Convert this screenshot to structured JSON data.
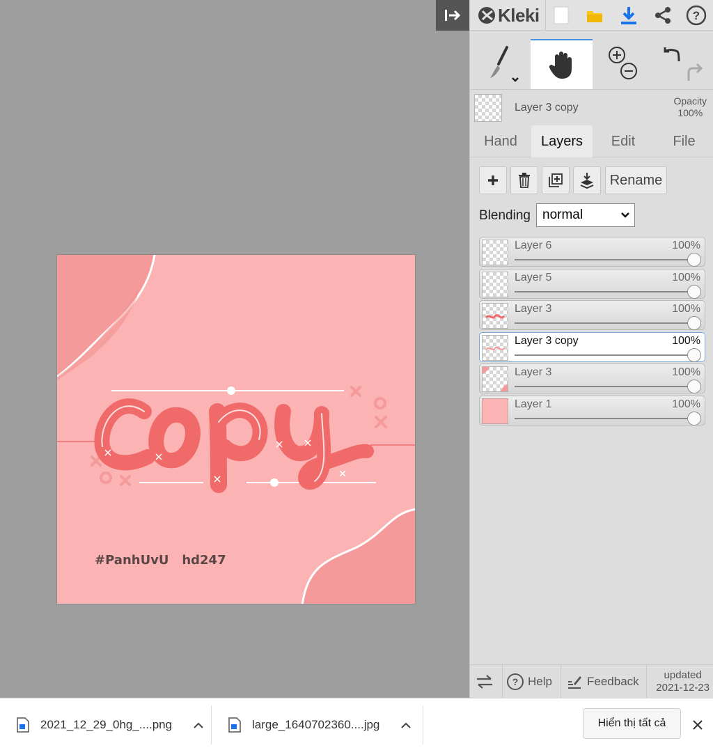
{
  "app": {
    "name": "Kleki",
    "colors": {
      "accent": "#1a73e8",
      "save_yellow": "#f5c518",
      "canvas_bg": "#fbb3b3",
      "panel_bg": "#dddddd"
    }
  },
  "toolbar": {
    "icons": [
      "new-image-icon",
      "open-folder-icon",
      "download-icon",
      "share-icon",
      "help-icon"
    ],
    "tools": [
      "brush-icon",
      "hand-icon",
      "zoom-in-icon",
      "zoom-out-icon",
      "undo-icon",
      "redo-icon"
    ],
    "active_tool": "hand"
  },
  "current_layer": {
    "name": "Layer 3 copy",
    "opacity_label": "Opacity",
    "opacity_value": "100%"
  },
  "tabs": [
    {
      "label": "Hand",
      "active": false
    },
    {
      "label": "Layers",
      "active": true
    },
    {
      "label": "Edit",
      "active": false
    },
    {
      "label": "File",
      "active": false
    }
  ],
  "layers_panel": {
    "rename_label": "Rename",
    "blending_label": "Blending",
    "blending_value": "normal",
    "layers": [
      {
        "name": "Layer 6",
        "opacity": "100%",
        "selected": false
      },
      {
        "name": "Layer 5",
        "opacity": "100%",
        "selected": false
      },
      {
        "name": "Layer 3",
        "opacity": "100%",
        "selected": false
      },
      {
        "name": "Layer 3 copy",
        "opacity": "100%",
        "selected": true
      },
      {
        "name": "Layer 3",
        "opacity": "100%",
        "selected": false
      },
      {
        "name": "Layer 1",
        "opacity": "100%",
        "selected": false
      }
    ]
  },
  "footer": {
    "help_label": "Help",
    "feedback_label": "Feedback",
    "updated_label": "updated",
    "updated_date": "2021-12-23"
  },
  "artwork": {
    "lettering": "copy",
    "hashtag": "#PanhUvU   hd247"
  },
  "download_bar": {
    "items": [
      {
        "name": "2021_12_29_0hg_....png"
      },
      {
        "name": "large_1640702360....jpg"
      }
    ],
    "show_all_label": "Hiển thị tất cả"
  }
}
